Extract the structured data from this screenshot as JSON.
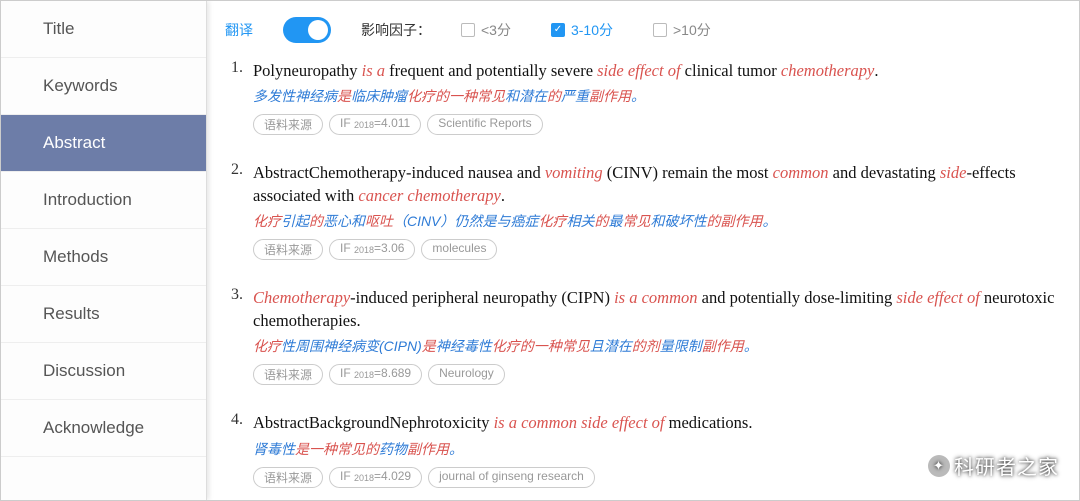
{
  "sidebar": {
    "items": [
      {
        "label": "Title",
        "active": false
      },
      {
        "label": "Keywords",
        "active": false
      },
      {
        "label": "Abstract",
        "active": true
      },
      {
        "label": "Introduction",
        "active": false
      },
      {
        "label": "Methods",
        "active": false
      },
      {
        "label": "Results",
        "active": false
      },
      {
        "label": "Discussion",
        "active": false
      },
      {
        "label": "Acknowledge",
        "active": false
      }
    ]
  },
  "filter": {
    "translate_label": "翻译",
    "if_label": "影响因子：",
    "options": [
      {
        "label": "<3分",
        "checked": false
      },
      {
        "label": "3-10分",
        "checked": true
      },
      {
        "label": ">10分",
        "checked": false
      }
    ]
  },
  "results": [
    {
      "num": "1.",
      "en_segments": [
        {
          "t": "Polyneuropathy ",
          "h": false
        },
        {
          "t": "is a",
          "h": true
        },
        {
          "t": " frequent and potentially severe ",
          "h": false
        },
        {
          "t": "side effect of",
          "h": true
        },
        {
          "t": " clinical tumor ",
          "h": false
        },
        {
          "t": "chemotherapy",
          "h": true
        },
        {
          "t": ".",
          "h": false
        }
      ],
      "zh_segments": [
        {
          "t": "多发性神经病",
          "h": false
        },
        {
          "t": "是",
          "h": true
        },
        {
          "t": "临床肿瘤",
          "h": false
        },
        {
          "t": "化疗的一种常见",
          "h": true
        },
        {
          "t": "和潜在",
          "h": false
        },
        {
          "t": "的",
          "h": true
        },
        {
          "t": "严重",
          "h": false
        },
        {
          "t": "副作用",
          "h": true
        },
        {
          "t": "。",
          "h": false
        }
      ],
      "tags": [
        "语料来源",
        "IF₂₀₁₈=4.011",
        "Scientific Reports"
      ]
    },
    {
      "num": "2.",
      "en_segments": [
        {
          "t": "AbstractChemotherapy-induced nausea and ",
          "h": false
        },
        {
          "t": "vomiting",
          "h": true
        },
        {
          "t": " (CINV) remain the most ",
          "h": false
        },
        {
          "t": "common",
          "h": true
        },
        {
          "t": " and devastating ",
          "h": false
        },
        {
          "t": "side",
          "h": true
        },
        {
          "t": "-effects associated with ",
          "h": false
        },
        {
          "t": "cancer chemotherapy",
          "h": true
        },
        {
          "t": ".",
          "h": false
        }
      ],
      "zh_segments": [
        {
          "t": "化疗",
          "h": true
        },
        {
          "t": "引起",
          "h": false
        },
        {
          "t": "的",
          "h": true
        },
        {
          "t": "恶心和",
          "h": false
        },
        {
          "t": "呕吐",
          "h": true
        },
        {
          "t": "（CINV）仍然是与癌症",
          "h": false
        },
        {
          "t": "化疗",
          "h": true
        },
        {
          "t": "相关",
          "h": false
        },
        {
          "t": "的",
          "h": true
        },
        {
          "t": "最",
          "h": false
        },
        {
          "t": "常见",
          "h": true
        },
        {
          "t": "和破坏性",
          "h": false
        },
        {
          "t": "的副作用",
          "h": true
        },
        {
          "t": "。",
          "h": false
        }
      ],
      "tags": [
        "语料来源",
        "IF₂₀₁₈=3.06",
        "molecules"
      ]
    },
    {
      "num": "3.",
      "en_segments": [
        {
          "t": "Chemotherapy",
          "h": true
        },
        {
          "t": "-induced peripheral neuropathy (CIPN) ",
          "h": false
        },
        {
          "t": "is a common",
          "h": true
        },
        {
          "t": " and potentially dose-limiting ",
          "h": false
        },
        {
          "t": "side effect of",
          "h": true
        },
        {
          "t": " neurotoxic chemotherapies.",
          "h": false
        }
      ],
      "zh_segments": [
        {
          "t": "化疗",
          "h": true
        },
        {
          "t": "性周围神经病变(CIPN)",
          "h": false
        },
        {
          "t": "是",
          "h": true
        },
        {
          "t": "神经毒性",
          "h": false
        },
        {
          "t": "化疗的一种常见",
          "h": true
        },
        {
          "t": "且潜在",
          "h": false
        },
        {
          "t": "的剂",
          "h": true
        },
        {
          "t": "量限制",
          "h": false
        },
        {
          "t": "副作用",
          "h": true
        },
        {
          "t": "。",
          "h": false
        }
      ],
      "tags": [
        "语料来源",
        "IF₂₀₁₈=8.689",
        "Neurology"
      ]
    },
    {
      "num": "4.",
      "en_segments": [
        {
          "t": "AbstractBackgroundNephrotoxicity ",
          "h": false
        },
        {
          "t": "is a common side effect of",
          "h": true
        },
        {
          "t": " medications.",
          "h": false
        }
      ],
      "zh_segments": [
        {
          "t": "肾毒性",
          "h": false
        },
        {
          "t": "是一种常见的",
          "h": true
        },
        {
          "t": "药物",
          "h": false
        },
        {
          "t": "副作用",
          "h": true
        },
        {
          "t": "。",
          "h": false
        }
      ],
      "tags": [
        "语料来源",
        "IF₂₀₁₈=4.029",
        "journal of ginseng research"
      ]
    }
  ],
  "watermark": "科研者之家"
}
